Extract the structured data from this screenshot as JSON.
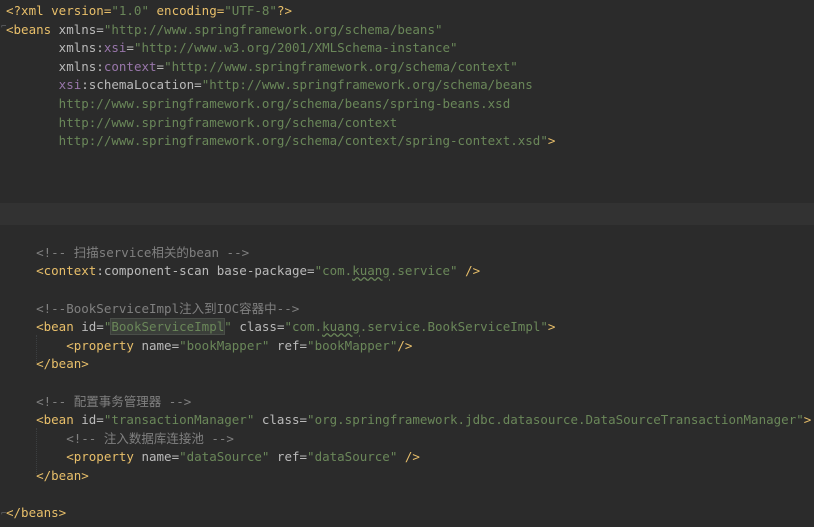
{
  "editor": {
    "theme_colors": {
      "background": "#2b2b2b",
      "tag": "#e8bf6a",
      "attribute": "#bababa",
      "namespace": "#9876aa",
      "value": "#6a8759",
      "comment": "#808080"
    },
    "lines": [
      {
        "segments": [
          {
            "cls": "pi",
            "text": "<?xml version="
          },
          {
            "cls": "val",
            "text": "\"1.0\""
          },
          {
            "cls": "pi",
            "text": " encoding="
          },
          {
            "cls": "val",
            "text": "\"UTF-8\""
          },
          {
            "cls": "pi",
            "text": "?>"
          }
        ]
      },
      {
        "segments": [
          {
            "cls": "tag",
            "text": "<beans"
          },
          {
            "cls": "attr",
            "text": " xmlns="
          },
          {
            "cls": "val",
            "text": "\"http://www.springframework.org/schema/beans\""
          }
        ]
      },
      {
        "segments": [
          {
            "cls": "attr",
            "text": "       xmlns:"
          },
          {
            "cls": "ns",
            "text": "xsi"
          },
          {
            "cls": "attr",
            "text": "="
          },
          {
            "cls": "val",
            "text": "\"http://www.w3.org/2001/XMLSchema-instance\""
          }
        ]
      },
      {
        "segments": [
          {
            "cls": "attr",
            "text": "       xmlns:"
          },
          {
            "cls": "ns",
            "text": "context"
          },
          {
            "cls": "attr",
            "text": "="
          },
          {
            "cls": "val",
            "text": "\"http://www.springframework.org/schema/context\""
          }
        ]
      },
      {
        "segments": [
          {
            "cls": "ns",
            "text": "       xsi"
          },
          {
            "cls": "attr",
            "text": ":schemaLocation="
          },
          {
            "cls": "val",
            "text": "\"http://www.springframework.org/schema/beans"
          }
        ]
      },
      {
        "segments": [
          {
            "cls": "val",
            "text": "       http://www.springframework.org/schema/beans/spring-beans.xsd"
          }
        ]
      },
      {
        "segments": [
          {
            "cls": "val",
            "text": "       http://www.springframework.org/schema/context"
          }
        ]
      },
      {
        "segments": [
          {
            "cls": "val",
            "text": "       http://www.springframework.org/schema/context/spring-context.xsd\""
          },
          {
            "cls": "tag",
            "text": ">"
          }
        ]
      },
      {
        "segments": []
      },
      {
        "segments": []
      },
      {
        "segments": []
      },
      {
        "segments": []
      },
      {
        "segments": []
      },
      {
        "segments": [
          {
            "cls": "com",
            "text": "    <!-- 扫描service相关的bean -->"
          }
        ]
      },
      {
        "segments": [
          {
            "cls": "tag",
            "text": "    <context"
          },
          {
            "cls": "attr",
            "text": ":component-scan"
          },
          {
            "cls": "attr",
            "text": " base-package="
          },
          {
            "cls": "val",
            "text": "\"com."
          },
          {
            "cls": "val typo",
            "text": "kuang"
          },
          {
            "cls": "val",
            "text": ".service\""
          },
          {
            "cls": "tag",
            "text": " />"
          }
        ]
      },
      {
        "segments": []
      },
      {
        "segments": [
          {
            "cls": "com",
            "text": "    <!--BookServiceImpl注入到IOC容器中-->"
          }
        ]
      },
      {
        "segments": [
          {
            "cls": "tag",
            "text": "    <bean"
          },
          {
            "cls": "attr",
            "text": " id="
          },
          {
            "cls": "val",
            "text": "\""
          },
          {
            "cls": "val sel",
            "text": "BookServiceImpl"
          },
          {
            "cls": "val",
            "text": "\""
          },
          {
            "cls": "attr",
            "text": " class="
          },
          {
            "cls": "val",
            "text": "\"com."
          },
          {
            "cls": "val typo",
            "text": "kuang"
          },
          {
            "cls": "val",
            "text": ".service.BookServiceImpl\""
          },
          {
            "cls": "tag",
            "text": ">"
          }
        ]
      },
      {
        "segments": [
          {
            "cls": "tag",
            "text": "        <property"
          },
          {
            "cls": "attr",
            "text": " name="
          },
          {
            "cls": "val",
            "text": "\"bookMapper\""
          },
          {
            "cls": "attr",
            "text": " ref="
          },
          {
            "cls": "val",
            "text": "\"bookMapper\""
          },
          {
            "cls": "tag",
            "text": "/>"
          }
        ]
      },
      {
        "segments": [
          {
            "cls": "tag",
            "text": "    </bean>"
          }
        ]
      },
      {
        "segments": []
      },
      {
        "segments": [
          {
            "cls": "com",
            "text": "    <!-- 配置事务管理器 -->"
          }
        ]
      },
      {
        "segments": [
          {
            "cls": "tag",
            "text": "    <bean"
          },
          {
            "cls": "attr",
            "text": " id="
          },
          {
            "cls": "val",
            "text": "\"transactionManager\""
          },
          {
            "cls": "attr",
            "text": " class="
          },
          {
            "cls": "val",
            "text": "\"org.springframework.jdbc.datasource.DataSourceTransactionManager\""
          },
          {
            "cls": "tag",
            "text": ">"
          }
        ]
      },
      {
        "segments": [
          {
            "cls": "com",
            "text": "        <!-- 注入数据库连接池 -->"
          }
        ]
      },
      {
        "segments": [
          {
            "cls": "tag",
            "text": "        <property"
          },
          {
            "cls": "attr",
            "text": " name="
          },
          {
            "cls": "val",
            "text": "\"dataSource\""
          },
          {
            "cls": "attr",
            "text": " ref="
          },
          {
            "cls": "val",
            "text": "\"dataSource\""
          },
          {
            "cls": "tag",
            "text": " />"
          }
        ]
      },
      {
        "segments": [
          {
            "cls": "tag",
            "text": "    </bean>"
          }
        ]
      },
      {
        "segments": []
      },
      {
        "segments": [
          {
            "cls": "tag",
            "text": "</beans>"
          }
        ]
      }
    ]
  }
}
